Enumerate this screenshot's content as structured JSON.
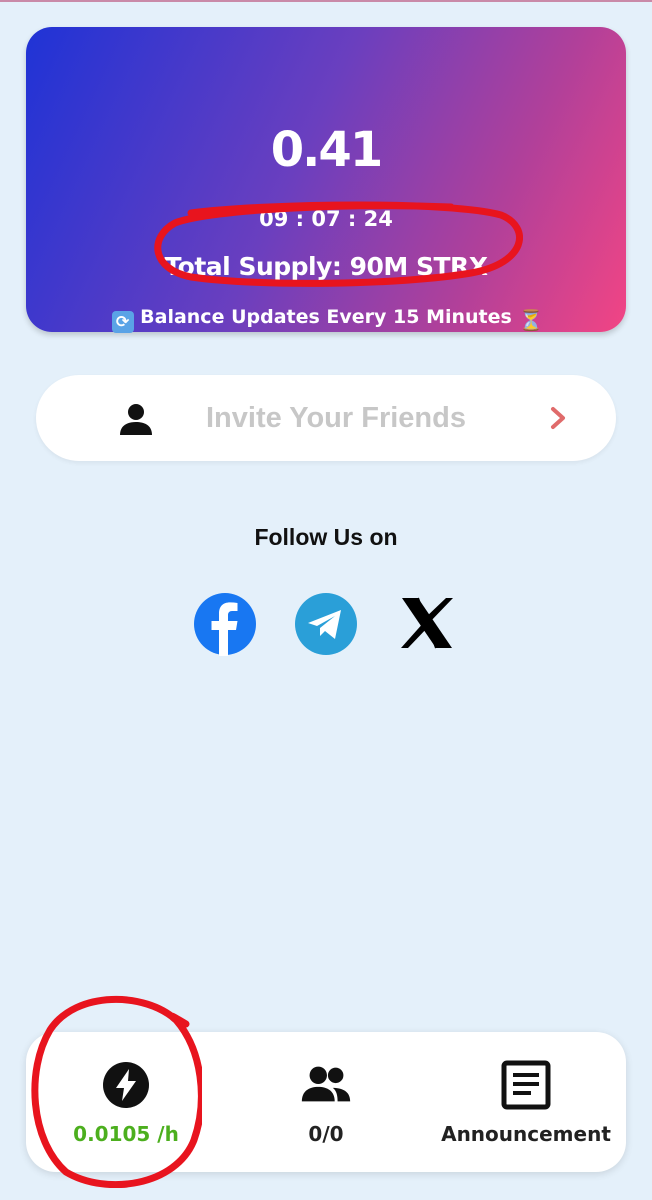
{
  "balance": {
    "value": "0.41",
    "timer": "09 : 07 : 24",
    "total_supply": "Total Supply: 90M STRX",
    "update_note": "Balance Updates Every 15 Minutes",
    "update_icon_left": "refresh-emoji",
    "update_icon_right": "hourglass-emoji"
  },
  "invite": {
    "label": "Invite Your Friends",
    "icon": "person-icon",
    "arrow_color": "#e06b6b"
  },
  "social": {
    "title": "Follow Us on",
    "links": [
      {
        "name": "facebook",
        "color": "#1877f2"
      },
      {
        "name": "telegram",
        "color": "#2a9fd8"
      },
      {
        "name": "x",
        "color": "#000000"
      }
    ]
  },
  "bottom_nav": {
    "mining_rate": "0.0105 /h",
    "team_count": "0/0",
    "announcement": "Announcement"
  },
  "colors": {
    "background": "#e4f0fa",
    "card_gradient_start": "#1f33d6",
    "card_gradient_end": "#f24584",
    "rate_green": "#4caf1e",
    "annotation_red": "#e8141e"
  }
}
